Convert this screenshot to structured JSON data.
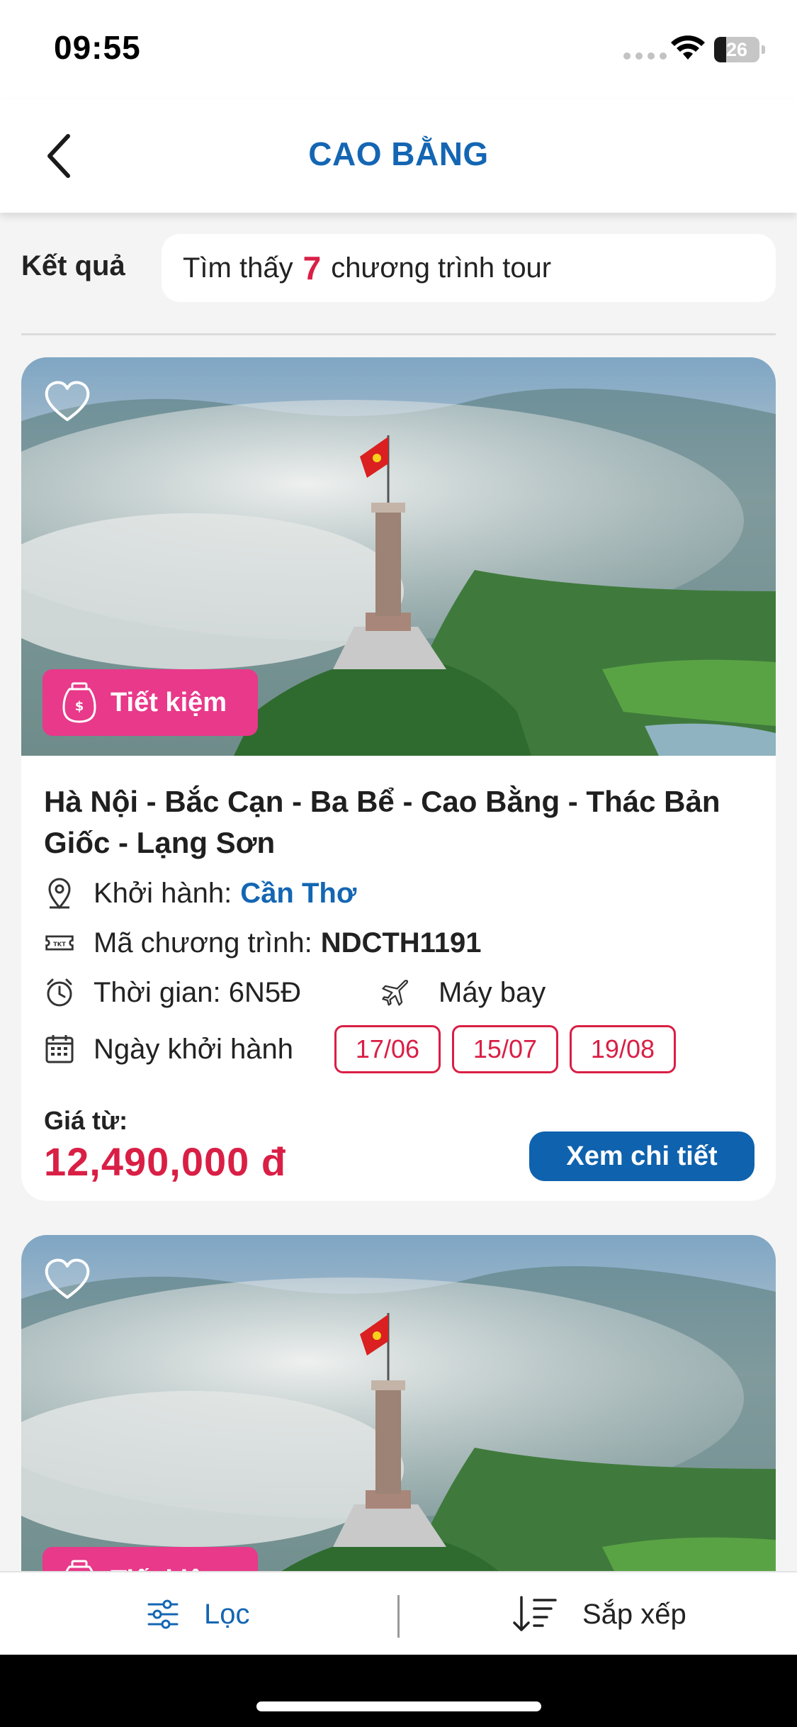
{
  "status_bar": {
    "time": "09:55",
    "battery_level": "26",
    "icons": [
      "signal-icon",
      "wifi-icon",
      "battery-icon"
    ]
  },
  "header": {
    "title": "CAO BẰNG",
    "back_icon": "chevron-left-icon"
  },
  "results": {
    "label": "Kết quả",
    "prefix": "Tìm thấy",
    "count": "7",
    "suffix": "chương trình tour"
  },
  "tours": [
    {
      "badge": "Tiết kiệm",
      "name": "Hà Nội - Bắc Cạn - Ba Bể - Cao Bằng - Thác Bản Giốc - Lạng Sơn",
      "departure_label": "Khởi hành:",
      "departure_city": "Cần Thơ",
      "code_label": "Mã chương trình:",
      "code": "NDCTH1191",
      "duration_label": "Thời gian: 6N5Đ",
      "transport": "Máy bay",
      "dates_label": "Ngày khởi hành",
      "dates": [
        "17/06",
        "15/07",
        "19/08"
      ],
      "price_label": "Giá từ:",
      "price": "12,490,000 đ",
      "detail_button": "Xem chi tiết"
    },
    {
      "badge": "Tiết kiệm"
    }
  ],
  "bottom_bar": {
    "filter_label": "Lọc",
    "sort_label": "Sắp xếp"
  },
  "colors": {
    "brand_blue": "#1466b3",
    "accent_red": "#d91f45",
    "badge_pink": "#e8398a",
    "button_blue": "#0f62ae"
  }
}
